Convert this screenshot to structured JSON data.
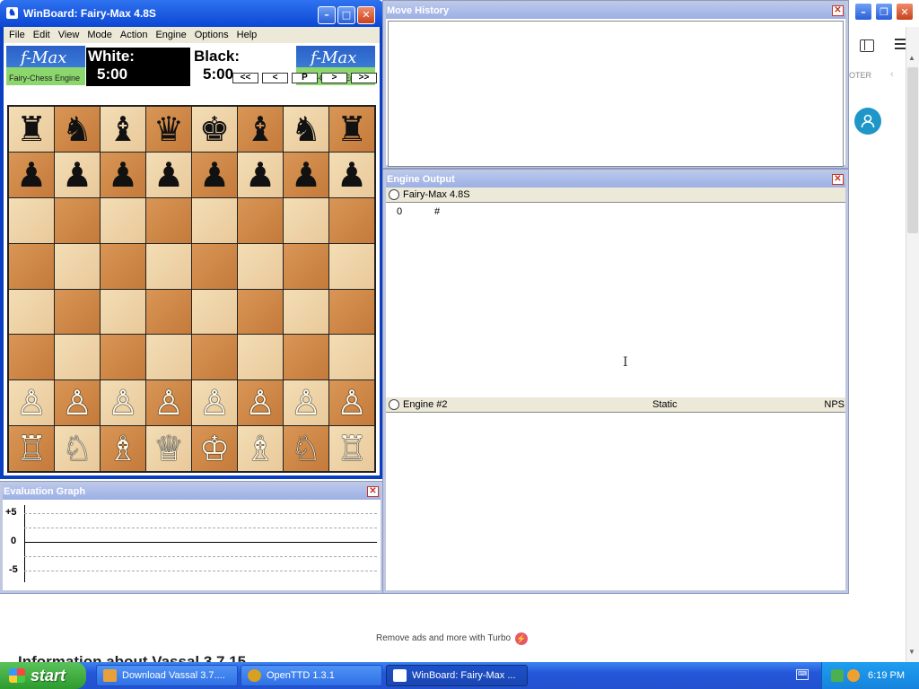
{
  "browser": {
    "side_label": "OTER",
    "ads_text": "Remove ads and more with Turbo",
    "page_heading": "Information about Vassal 3.7.15"
  },
  "winboard": {
    "title": "WinBoard: Fairy-Max 4.8S",
    "menu": [
      "File",
      "Edit",
      "View",
      "Mode",
      "Action",
      "Engine",
      "Options",
      "Help"
    ],
    "logo_text": "f-Max",
    "logo_sub": "Fairy-Chess Engine",
    "white_label": "White:",
    "white_time": "5:00",
    "black_label": "Black:",
    "black_time": "5:00",
    "nav_buttons": [
      "<<",
      "<",
      "P",
      ">",
      ">>"
    ],
    "board": [
      [
        "♜",
        "♞",
        "♝",
        "♛",
        "♚",
        "♝",
        "♞",
        "♜"
      ],
      [
        "♟",
        "♟",
        "♟",
        "♟",
        "♟",
        "♟",
        "♟",
        "♟"
      ],
      [
        "",
        "",
        "",
        "",
        "",
        "",
        "",
        ""
      ],
      [
        "",
        "",
        "",
        "",
        "",
        "",
        "",
        ""
      ],
      [
        "",
        "",
        "",
        "",
        "",
        "",
        "",
        ""
      ],
      [
        "",
        "",
        "",
        "",
        "",
        "",
        "",
        ""
      ],
      [
        "♙",
        "♙",
        "♙",
        "♙",
        "♙",
        "♙",
        "♙",
        "♙"
      ],
      [
        "♖",
        "♘",
        "♗",
        "♕",
        "♔",
        "♗",
        "♘",
        "♖"
      ]
    ]
  },
  "eval_graph": {
    "title": "Evaluation Graph",
    "labels": [
      "+5",
      "0",
      "-5"
    ]
  },
  "move_history": {
    "title": "Move History"
  },
  "engine_output": {
    "title": "Engine Output",
    "engine1_name": "Fairy-Max 4.8S",
    "engine1_depth": "0",
    "engine1_hash": "#",
    "engine2_name": "Engine #2",
    "engine2_static": "Static",
    "engine2_nps": "NPS"
  },
  "taskbar": {
    "start_label": "start",
    "tasks": [
      "Download Vassal 3.7....",
      "OpenTTD 1.3.1",
      "WinBoard: Fairy-Max ..."
    ],
    "clock": "6:19 PM"
  },
  "colors": {
    "xp_blue": "#0b46d4",
    "light_square": "#f3ddb5",
    "dark_square": "#d99656",
    "tool_title": "#9db0e4"
  }
}
